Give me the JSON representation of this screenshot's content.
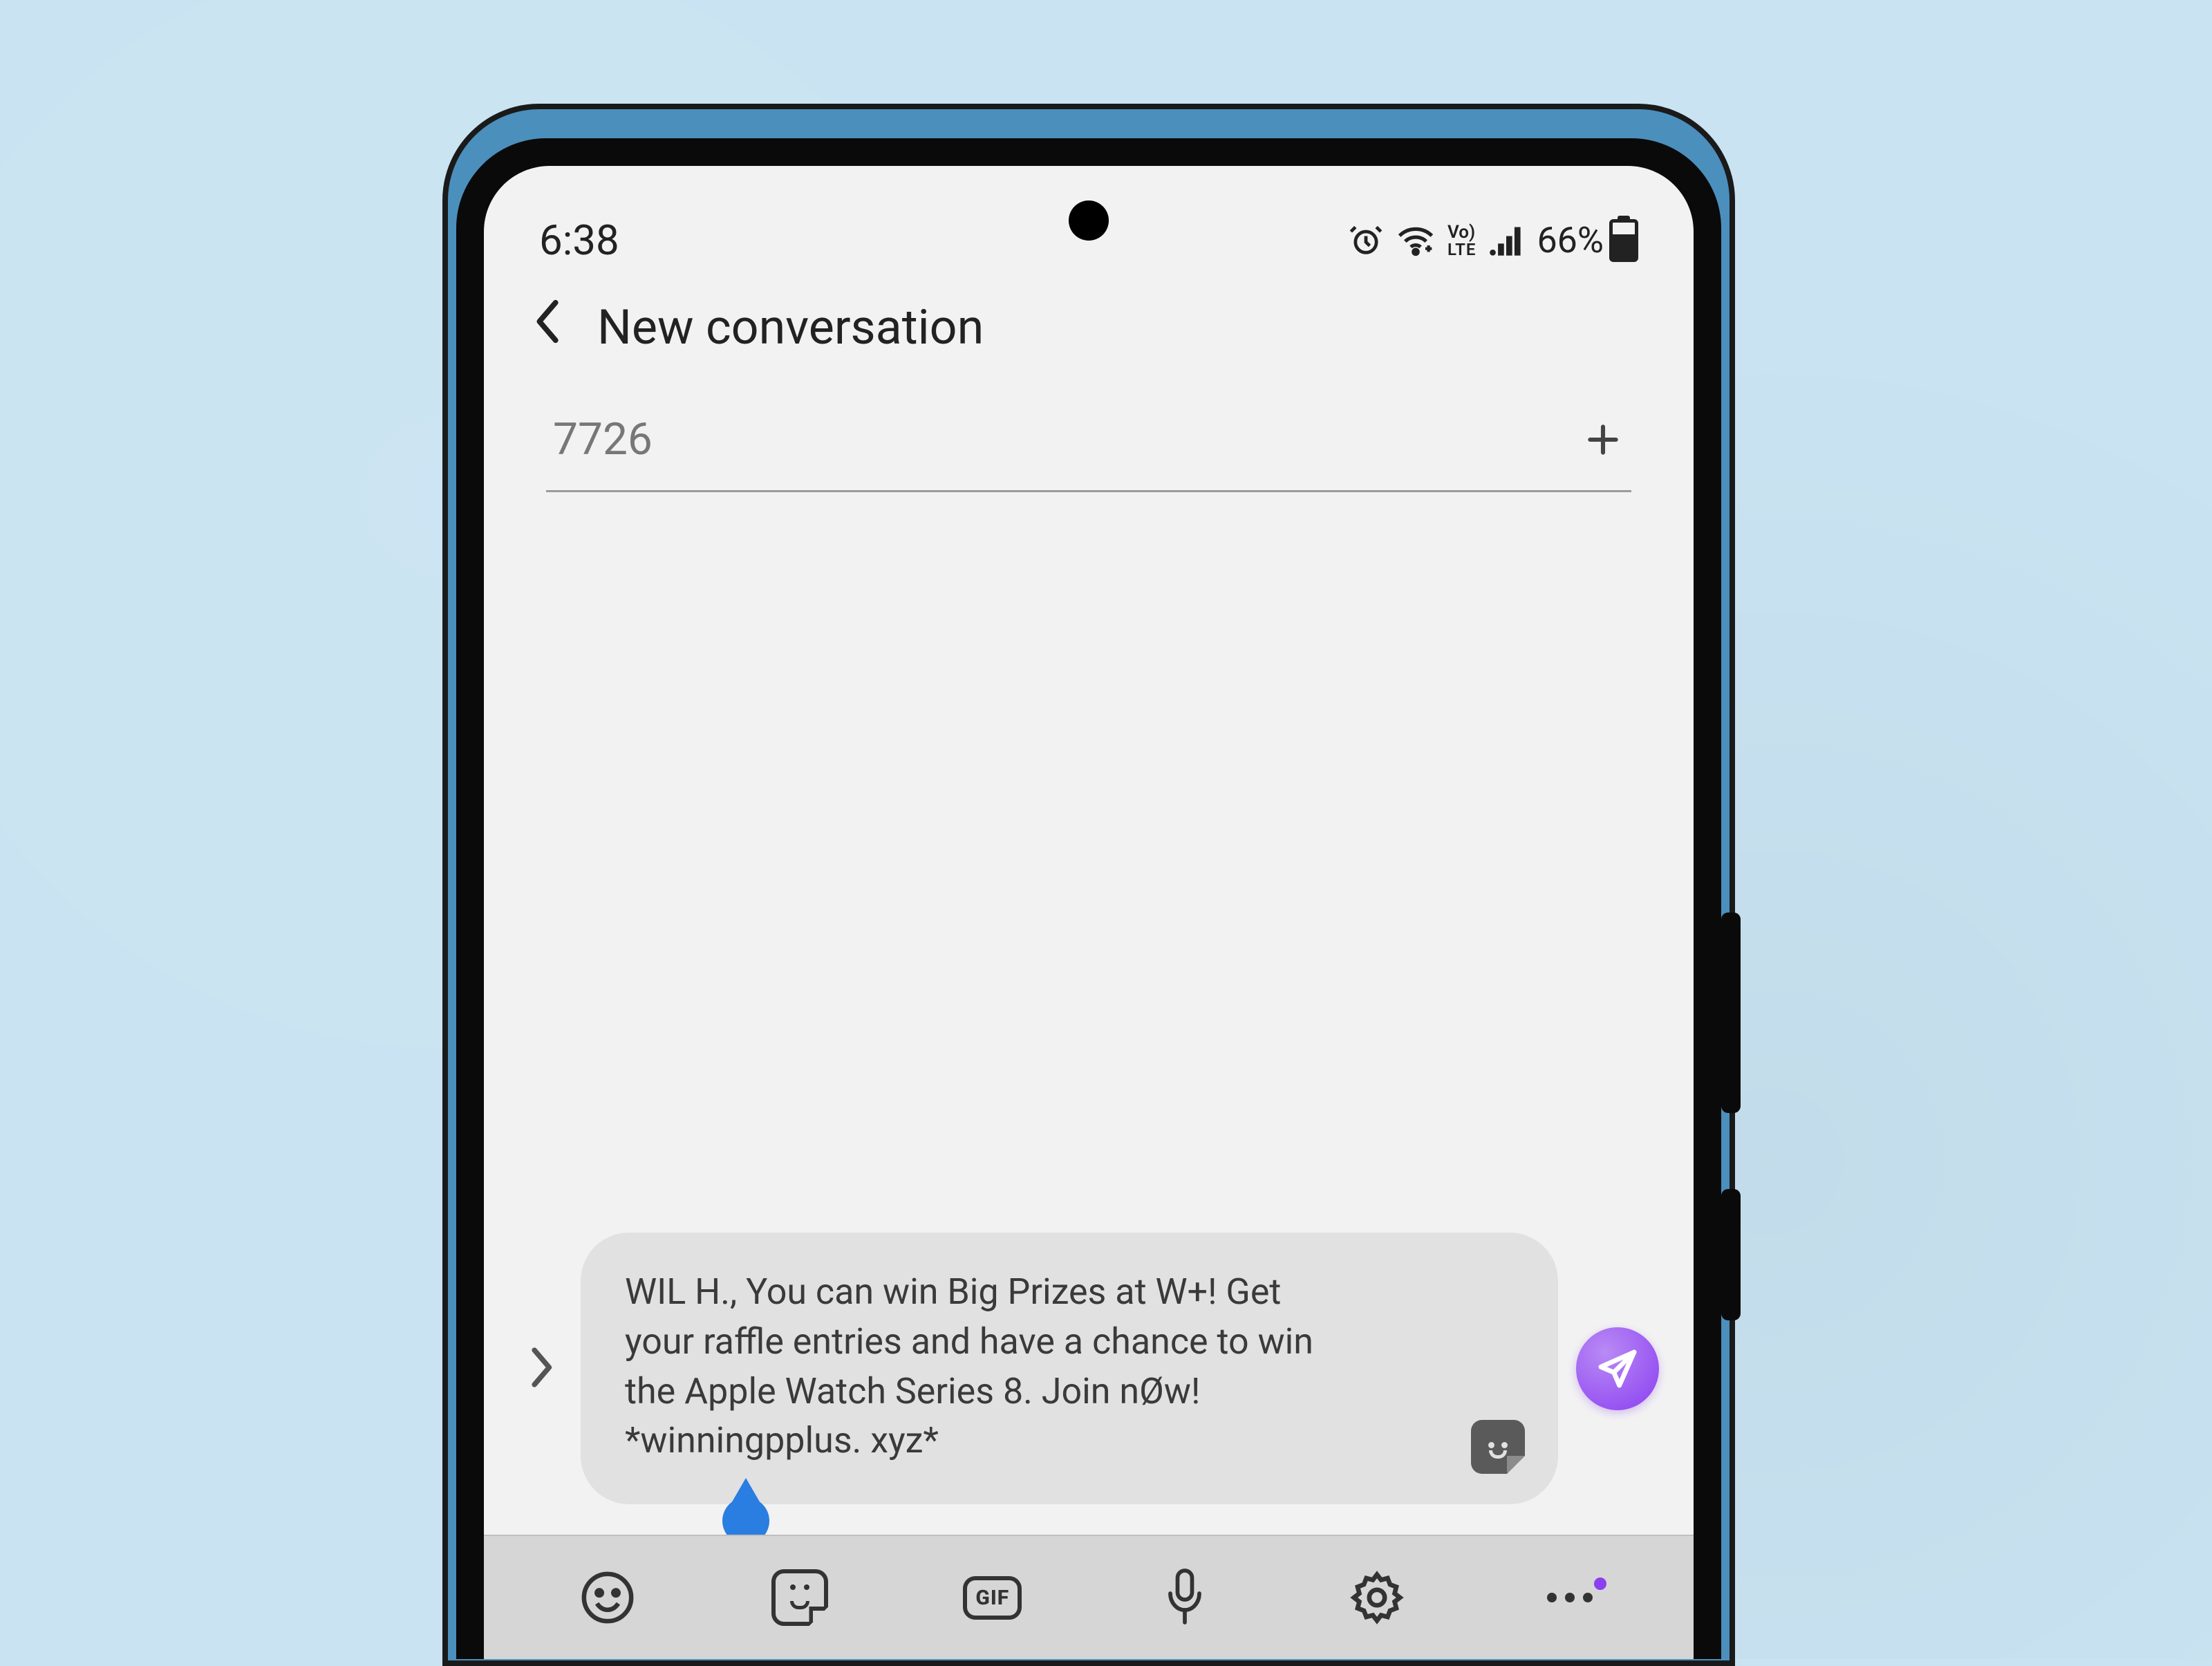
{
  "status": {
    "time": "6:38",
    "battery_pct": "66%",
    "battery_fill_pct": 66,
    "volte_top": "Vo)",
    "volte_bottom": "LTE"
  },
  "header": {
    "title": "New conversation"
  },
  "recipient": {
    "value": "7726"
  },
  "message": {
    "text": "WIL H., You can win Big Prizes at W+! Get your raffle entries and have a chance to win the Apple Watch Series 8. Join nØw! *winningpplus. xyz*"
  },
  "keyboard": {
    "gif_label": "GIF"
  },
  "icons": {
    "alarm": "alarm-icon",
    "wifi": "wifi-icon",
    "signal": "signal-icon",
    "battery": "battery-icon",
    "back": "chevron-left-icon",
    "add": "plus-icon",
    "expand": "chevron-right-icon",
    "attach_sticker": "sticker-icon",
    "send": "send-icon",
    "emoji": "emoji-icon",
    "sticker": "sticker-icon",
    "gif": "gif-icon",
    "mic": "mic-icon",
    "settings": "gear-icon",
    "more": "more-icon"
  }
}
